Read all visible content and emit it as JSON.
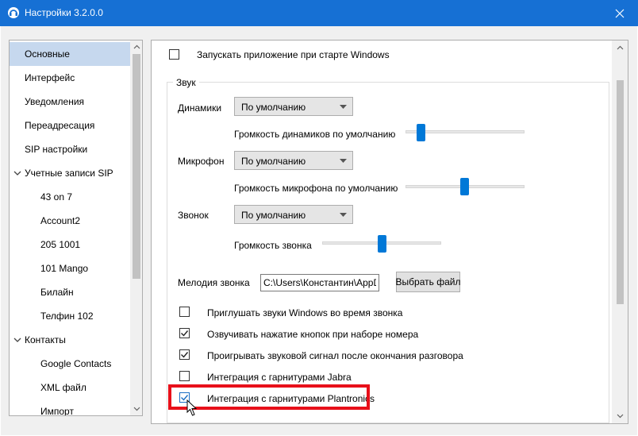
{
  "window": {
    "title": "Настройки 3.2.0.0",
    "accent_color": "#1670d4",
    "icon": "headset-app-icon",
    "close_icon": "close-icon"
  },
  "sidebar": {
    "items": [
      {
        "label": "Основные",
        "selected": true
      },
      {
        "label": "Интерфейс"
      },
      {
        "label": "Уведомления"
      },
      {
        "label": "Переадресация"
      },
      {
        "label": "SIP настройки"
      },
      {
        "label": "Учетные записи SIP",
        "expanded": true
      },
      {
        "label": "43 on 7"
      },
      {
        "label": "Account2"
      },
      {
        "label": "205 1001"
      },
      {
        "label": "101 Mango"
      },
      {
        "label": "Билайн"
      },
      {
        "label": "Телфин 102"
      },
      {
        "label": "Контакты",
        "expanded": true
      },
      {
        "label": "Google Contacts"
      },
      {
        "label": "XML файл"
      },
      {
        "label": "Импорт"
      }
    ]
  },
  "main": {
    "autostart": {
      "label": "Запускать приложение при старте Windows",
      "checked": false
    },
    "sound_group": {
      "title": "Звук",
      "speakers": {
        "label": "Динамики",
        "value": "По умолчанию",
        "volume_label": "Громкость динамиков по умолчанию",
        "volume": 0.13
      },
      "microphone": {
        "label": "Микрофон",
        "value": "По умолчанию",
        "volume_label": "Громкость микрофона по умолчанию",
        "volume": 0.5
      },
      "ring": {
        "label": "Звонок",
        "value": "По умолчанию",
        "volume_label": "Громкость звонка",
        "volume": 0.5
      },
      "ringtone": {
        "label": "Мелодия звонка",
        "path": "C:\\Users\\Константин\\AppDat",
        "browse_label": "Выбрать файл"
      },
      "options": [
        {
          "label": "Приглушать звуки Windows во время звонка",
          "checked": false
        },
        {
          "label": "Озвучивать нажатие кнопок при наборе номера",
          "checked": true
        },
        {
          "label": "Проигрывать звуковой сигнал после окончания разговора",
          "checked": true
        },
        {
          "label": "Интеграция с гарнитурами Jabra",
          "checked": false
        },
        {
          "label": "Интеграция с гарнитурами Plantronics",
          "checked": true,
          "highlighted": true
        }
      ]
    }
  },
  "colors": {
    "highlight": "#e8101a",
    "slider": "#0078d7",
    "selection": "#c6d8ee"
  }
}
